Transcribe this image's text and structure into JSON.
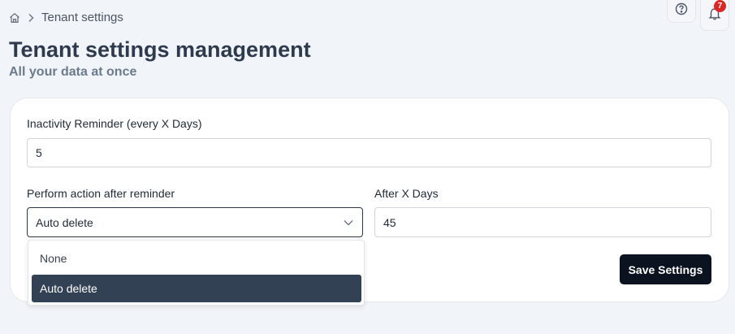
{
  "breadcrumb": {
    "current": "Tenant settings"
  },
  "header": {
    "help_icon": "help-circle-icon",
    "notification_icon": "bell-icon",
    "notification_count": "7"
  },
  "page": {
    "title": "Tenant settings management",
    "subtitle": "All your data at once"
  },
  "form": {
    "inactivity": {
      "label": "Inactivity Reminder (every X Days)",
      "value": "5"
    },
    "action": {
      "label": "Perform action after reminder",
      "value": "Auto delete",
      "options": [
        "None",
        "Auto delete"
      ],
      "selected_index": 1
    },
    "after_days": {
      "label": "After X Days",
      "value": "45"
    },
    "save_label": "Save Settings"
  },
  "colors": {
    "background": "#f1f4f9",
    "selected_option": "#334155",
    "primary_button": "#0b1220",
    "badge": "#dc2626"
  }
}
